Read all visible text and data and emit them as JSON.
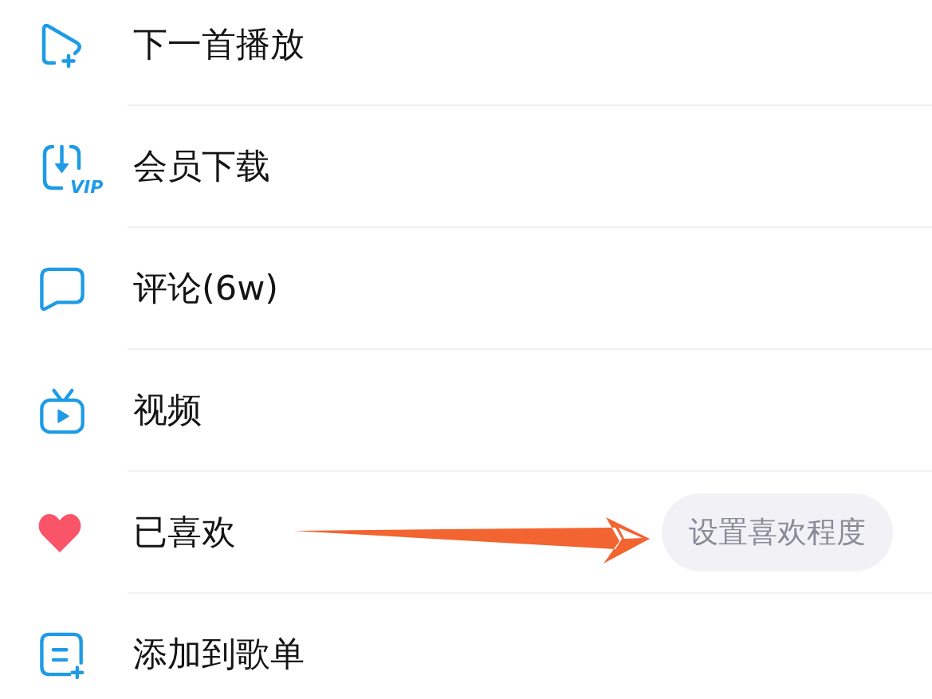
{
  "menu": {
    "items": [
      {
        "kind": "action",
        "label": "下一首播放"
      },
      {
        "kind": "action",
        "label": "会员下载",
        "icon_badge": "VIP"
      },
      {
        "kind": "action",
        "label": "评论(6w)"
      },
      {
        "kind": "action",
        "label": "视频"
      },
      {
        "kind": "like",
        "label": "已喜欢",
        "liked": true,
        "chip": "设置喜欢程度"
      },
      {
        "kind": "action",
        "label": "添加到歌单"
      }
    ]
  }
}
